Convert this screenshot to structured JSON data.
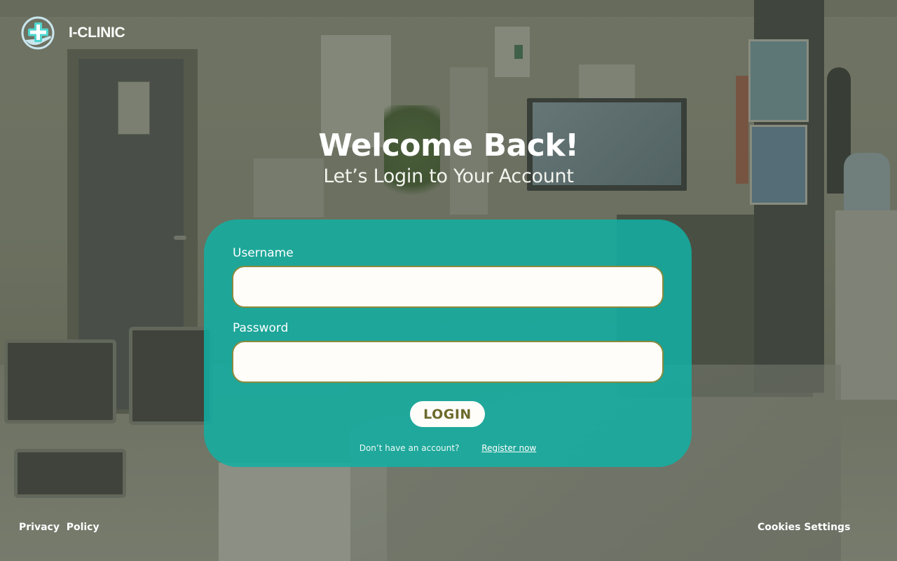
{
  "brand": {
    "name": "I-CLINIC",
    "logo_icon": "medical-cross-hand-icon",
    "colors": {
      "accent": "#4fd6cf",
      "ring": "#c9e6ee"
    }
  },
  "hero": {
    "title": "Welcome Back!",
    "subtitle": "Let’s Login to Your Account"
  },
  "login_form": {
    "username_label": "Username",
    "username_value": "",
    "password_label": "Password",
    "password_value": "",
    "login_button": "LOGIN",
    "register_prompt": "Don’t have an account?",
    "register_link": "Register now",
    "colors": {
      "card": "#12b0a3",
      "input_border": "#8b8a3c",
      "button_text": "#6c6a2b"
    }
  },
  "footer": {
    "privacy": "Privacy  Policy",
    "cookies": "Cookies Settings"
  }
}
